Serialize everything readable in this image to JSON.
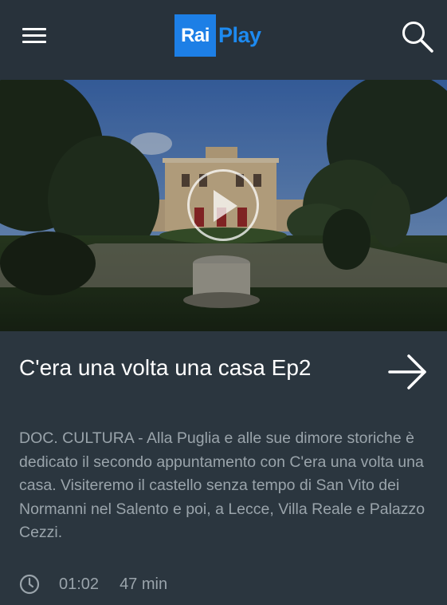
{
  "header": {
    "logo_rai": "Rai",
    "logo_play": "Play",
    "brand_color": "#1d7fe6"
  },
  "icons": {
    "menu": "hamburger-menu-icon",
    "search": "search-icon",
    "play": "play-icon",
    "arrow": "arrow-right-icon",
    "clock": "clock-icon"
  },
  "program": {
    "title": "C'era una volta una casa Ep2",
    "description": "DOC. CULTURA - Alla Puglia e alle sue dimore storiche è dedicato il secondo appuntamento con C'era una volta una casa. Visiteremo il castello senza tempo di  San Vito dei Normanni nel Salento e poi, a Lecce, Villa Reale e Palazzo Cezzi.",
    "time": "01:02",
    "duration": "47 min"
  }
}
